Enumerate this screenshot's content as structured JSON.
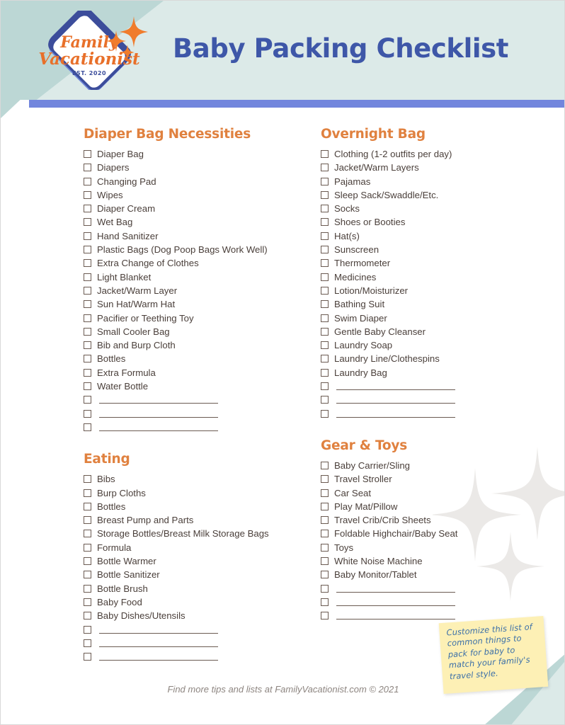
{
  "header": {
    "title": "Baby Packing Checklist",
    "logo": {
      "line1": "Family",
      "line2": "Vacationist",
      "est": "EST. 2020"
    },
    "colors": {
      "band": "#dceae8",
      "wedge": "#bcd7d5",
      "divider": "#7286dd",
      "title": "#3e57a8",
      "logo_orange": "#e8702a",
      "logo_blue": "#3c4d9b"
    }
  },
  "accent": {
    "heading_orange": "#e0813f",
    "item_text": "#4a3f3a"
  },
  "columns": {
    "left": [
      {
        "title": "Diaper Bag Necessities",
        "items": [
          "Diaper Bag",
          "Diapers",
          "Changing Pad",
          "Wipes",
          "Diaper Cream",
          "Wet Bag",
          "Hand Sanitizer",
          "Plastic Bags (Dog Poop Bags Work Well)",
          "Extra Change of Clothes",
          "Light Blanket",
          "Jacket/Warm Layer",
          "Sun Hat/Warm Hat",
          "Pacifier or Teething Toy",
          "Small Cooler Bag",
          "Bib and Burp Cloth",
          "Bottles",
          "Extra Formula",
          "Water Bottle"
        ],
        "blanks": 3
      },
      {
        "title": "Eating",
        "items": [
          "Bibs",
          "Burp Cloths",
          "Bottles",
          "Breast Pump and Parts",
          "Storage Bottles/Breast Milk Storage Bags",
          "Formula",
          "Bottle Warmer",
          "Bottle Sanitizer",
          "Bottle Brush",
          "Baby Food",
          "Baby Dishes/Utensils"
        ],
        "blanks": 3
      }
    ],
    "right": [
      {
        "title": "Overnight Bag",
        "items": [
          "Clothing (1-2 outfits per day)",
          "Jacket/Warm Layers",
          "Pajamas",
          "Sleep Sack/Swaddle/Etc.",
          "Socks",
          "Shoes or Booties",
          "Hat(s)",
          "Sunscreen",
          "Thermometer",
          "Medicines",
          "Lotion/Moisturizer",
          "Bathing Suit",
          "Swim Diaper",
          "Gentle Baby Cleanser",
          "Laundry Soap",
          "Laundry Line/Clothespins",
          "Laundry Bag"
        ],
        "blanks": 3
      },
      {
        "title": "Gear & Toys",
        "items": [
          "Baby Carrier/Sling",
          "Travel Stroller",
          "Car Seat",
          "Play Mat/Pillow",
          "Travel Crib/Crib Sheets",
          "Foldable Highchair/Baby Seat",
          "Toys",
          "White Noise Machine",
          "Baby Monitor/Tablet"
        ],
        "blanks": 3
      }
    ]
  },
  "sticky_note": {
    "text": "Customize this list of common things to pack for baby to match your family's travel style.",
    "background": "#fdf0b5",
    "text_color": "#3b6fa8"
  },
  "footer": {
    "text": "Find more tips and lists at FamilyVacationist.com © 2021"
  }
}
